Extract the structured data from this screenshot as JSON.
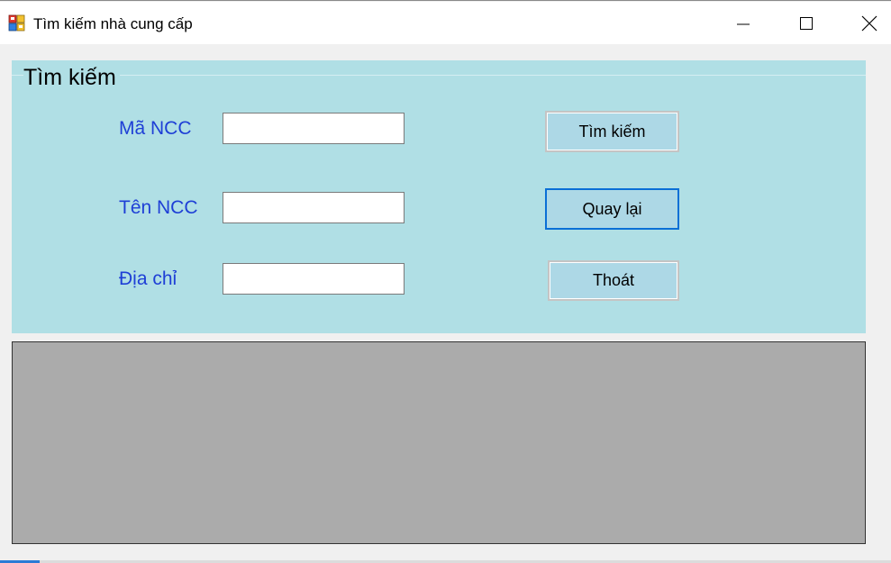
{
  "window": {
    "title": "Tìm kiếm nhà cung cấp",
    "icon": "winforms-app-icon",
    "controls": {
      "minimize_icon": "minimize-icon",
      "maximize_icon": "maximize-icon",
      "close_icon": "close-icon"
    }
  },
  "search_group": {
    "title": "Tìm kiếm",
    "background_color": "#b0dfe5",
    "fields": [
      {
        "label": "Mã NCC",
        "value": "",
        "placeholder": ""
      },
      {
        "label": "Tên NCC",
        "value": "",
        "placeholder": ""
      },
      {
        "label": "Địa chỉ",
        "value": "",
        "placeholder": ""
      }
    ],
    "buttons": {
      "search": "Tìm kiếm",
      "back": "Quay lại",
      "exit": "Thoát"
    }
  },
  "results_grid": {
    "background_color": "#ababab",
    "rows": []
  },
  "colors": {
    "label_text": "#1e3fd6",
    "button_bg": "#add8e6",
    "focus_border": "#0a6fd6"
  }
}
